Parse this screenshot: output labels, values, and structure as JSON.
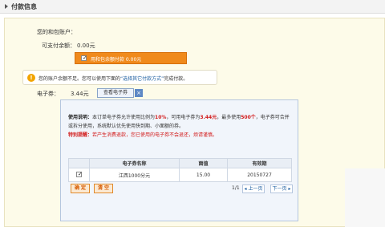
{
  "header": {
    "title": "付款信息"
  },
  "account": {
    "label": "您的和包账户：",
    "value": ""
  },
  "payable": {
    "label": "可支付余额：",
    "value": "0.00元"
  },
  "balance_option": {
    "checked": true,
    "text": "用和包余额付款 0.00元"
  },
  "notice": {
    "icon": "warning-icon",
    "text_before": "您的账户余额不足。您可以使用下面的",
    "link": "“选择其它付款方式”",
    "text_after": "完成付款。"
  },
  "coupon": {
    "label": "电子券：",
    "value": "3.44元",
    "button": "查看电子券",
    "toggle": "×"
  },
  "popup": {
    "usage": {
      "heading": "使用说明：",
      "s1": "本订单电子券允许使用比例为",
      "ratio": "10%",
      "s2": "，可用电子券为",
      "amount": "3.44元",
      "s3": "，最多使用",
      "count": "500个",
      "s4": "，电子券可合并或拆分使用，系统默认优先使用快到期、小面额的券。",
      "special_label": "特别提醒：",
      "special_text": "若产生消费退款，您已使用的电子券不会退还，烦请谨慎。"
    },
    "table": {
      "headers": [
        "",
        "电子券名称",
        "面值",
        "有效期"
      ],
      "rows": [
        {
          "checked": true,
          "name": "江西1000分元",
          "value": "15.00",
          "expiry": "20150727"
        }
      ]
    },
    "confirm": "确 定",
    "clear": "清 空",
    "pager": {
      "text": "1/1",
      "prev": "上一页",
      "next": "下一页"
    }
  },
  "colors": {
    "accent": "#f08a1c",
    "link": "#1a5ca0",
    "warning": "#d21a1a"
  }
}
